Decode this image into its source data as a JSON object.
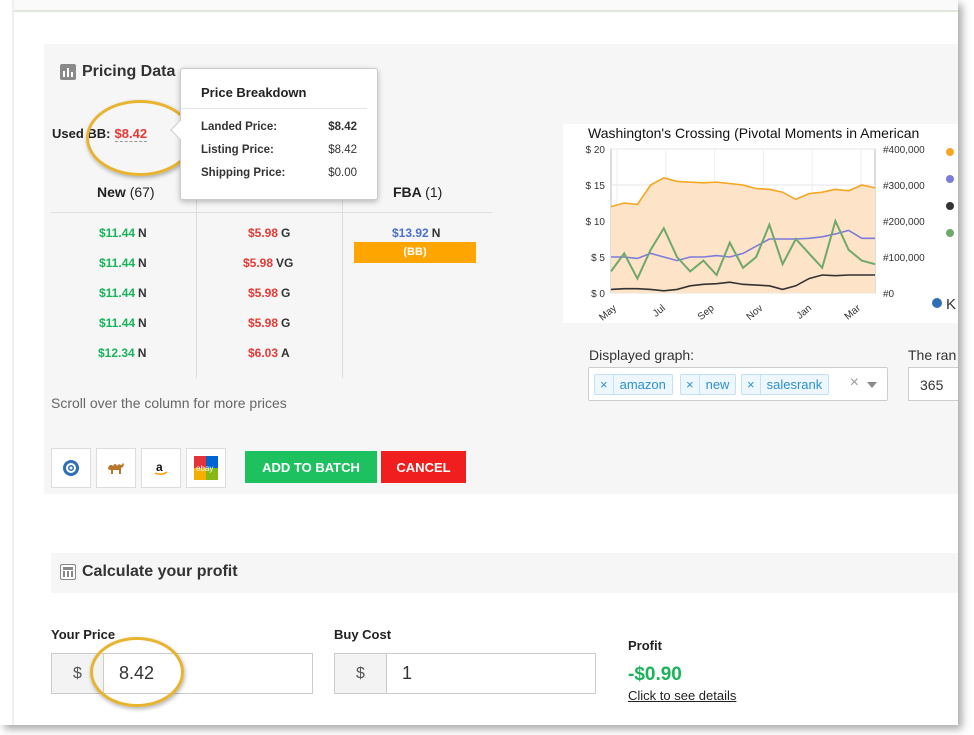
{
  "pricing": {
    "title": "Pricing Data",
    "used_bb_label": "Used BB:",
    "used_bb_value": "$8.42",
    "columns": [
      {
        "label": "New",
        "count": "(67)"
      },
      {
        "label": "FBA",
        "count": "(1)"
      }
    ],
    "new_offers": [
      {
        "price": "$11.44",
        "cond": "N"
      },
      {
        "price": "$11.44",
        "cond": "N"
      },
      {
        "price": "$11.44",
        "cond": "N"
      },
      {
        "price": "$11.44",
        "cond": "N"
      },
      {
        "price": "$12.34",
        "cond": "N"
      }
    ],
    "used_offers": [
      {
        "price": "$5.98",
        "cond": "G"
      },
      {
        "price": "$5.98",
        "cond": "VG"
      },
      {
        "price": "$5.98",
        "cond": "G"
      },
      {
        "price": "$5.98",
        "cond": "G"
      },
      {
        "price": "$6.03",
        "cond": "A"
      }
    ],
    "fba_offers": [
      {
        "price": "$13.92",
        "cond": "N",
        "badge": "(BB)"
      }
    ],
    "scroll_note": "Scroll over the column for more prices",
    "add_to_batch": "ADD TO BATCH",
    "cancel": "CANCEL",
    "icon_buttons": [
      "keepa-icon",
      "camel-icon",
      "amazon-icon",
      "ebay-icon"
    ]
  },
  "tooltip": {
    "title": "Price Breakdown",
    "rows": [
      {
        "label": "Landed Price:",
        "value": "$8.42"
      },
      {
        "label": "Listing Price:",
        "value": "$8.42"
      },
      {
        "label": "Shipping Price:",
        "value": "$0.00"
      }
    ]
  },
  "chart": {
    "title": "Washington's Crossing (Pivotal Moments in American",
    "legend_partial": "K"
  },
  "chart_data": {
    "type": "line",
    "title": "Washington's Crossing (Pivotal Moments in American",
    "x_tick_labels": [
      "May",
      "Jul",
      "Sep",
      "Nov",
      "Jan",
      "Mar"
    ],
    "y_left_ticks": [
      "$ 20",
      "$ 15",
      "$ 10",
      "$ 5",
      "$ 0"
    ],
    "y_left_range": [
      0,
      20
    ],
    "y_right_ticks": [
      "#400,000",
      "#300,000",
      "#200,000",
      "#100,000",
      "#0"
    ],
    "y_right_range": [
      0,
      400000
    ],
    "grid": true,
    "series": [
      {
        "color": "#f5a623",
        "axis": "left",
        "values": [
          12.0,
          12.5,
          12.3,
          15.0,
          16.0,
          15.5,
          15.4,
          15.3,
          15.4,
          15.2,
          15.0,
          14.5,
          14.4,
          14.0,
          13.0,
          13.8,
          14.0,
          14.4,
          14.2,
          15.0,
          14.6
        ]
      },
      {
        "color": "#7b7bdc",
        "axis": "left",
        "values": [
          5.0,
          5.0,
          4.8,
          5.5,
          5.0,
          4.5,
          5.0,
          5.0,
          5.2,
          5.0,
          5.5,
          6.5,
          7.5,
          7.5,
          7.5,
          7.6,
          7.8,
          8.2,
          8.7,
          7.6,
          7.6
        ]
      },
      {
        "color": "#333333",
        "axis": "left",
        "values": [
          0.5,
          0.6,
          0.6,
          0.5,
          0.3,
          0.5,
          1.0,
          1.2,
          1.3,
          1.5,
          1.2,
          1.1,
          1.0,
          0.5,
          1.0,
          2.0,
          2.5,
          2.4,
          2.5,
          2.5,
          2.5
        ]
      },
      {
        "color": "#6fa86a",
        "axis": "right",
        "values": [
          60000,
          110000,
          40000,
          120000,
          180000,
          100000,
          60000,
          90000,
          50000,
          140000,
          70000,
          100000,
          190000,
          80000,
          150000,
          110000,
          70000,
          200000,
          120000,
          90000,
          80000
        ]
      }
    ]
  },
  "displayed_graph": {
    "label": "Displayed graph:",
    "tags": [
      "amazon",
      "new",
      "salesrank"
    ],
    "clear": "×"
  },
  "range": {
    "label": "The ran",
    "value": "365"
  },
  "calc": {
    "title": "Calculate your profit",
    "your_price_label": "Your Price",
    "your_price_currency": "$",
    "your_price_value": "8.42",
    "buy_cost_label": "Buy Cost",
    "buy_cost_currency": "$",
    "buy_cost_value": "1",
    "profit_label": "Profit",
    "profit_value": "-$0.90",
    "profit_link": "Click to see details"
  },
  "colors": {
    "green": "#19b35a",
    "red": "#e53935",
    "blue": "#4a6fd0",
    "orange": "#ffa500",
    "highlight": "#e8b32e"
  }
}
